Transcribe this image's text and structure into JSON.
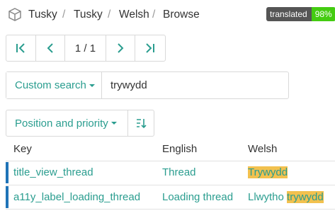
{
  "breadcrumb": {
    "items": [
      "Tusky",
      "Tusky",
      "Welsh",
      "Browse"
    ],
    "separator": "/"
  },
  "badge": {
    "label": "translated",
    "value": "98%",
    "label_color": "#555555",
    "value_color": "#44cc11"
  },
  "pager": {
    "position": "1 / 1"
  },
  "search": {
    "mode_label": "Custom search",
    "query": "trywydd"
  },
  "sort": {
    "label": "Position and priority"
  },
  "table": {
    "headers": [
      "Key",
      "English",
      "Welsh"
    ],
    "rows": [
      {
        "key": "title_view_thread",
        "english": "Thread",
        "welsh_prefix": "",
        "welsh_highlight": "Trywydd"
      },
      {
        "key": "a11y_label_loading_thread",
        "english": "Loading thread",
        "welsh_prefix": "Llwytho ",
        "welsh_highlight": "trywydd"
      }
    ]
  },
  "colors": {
    "accent": "#2a9d8f",
    "highlight": "#f2c14e",
    "row_marker": "#1f73b7"
  }
}
